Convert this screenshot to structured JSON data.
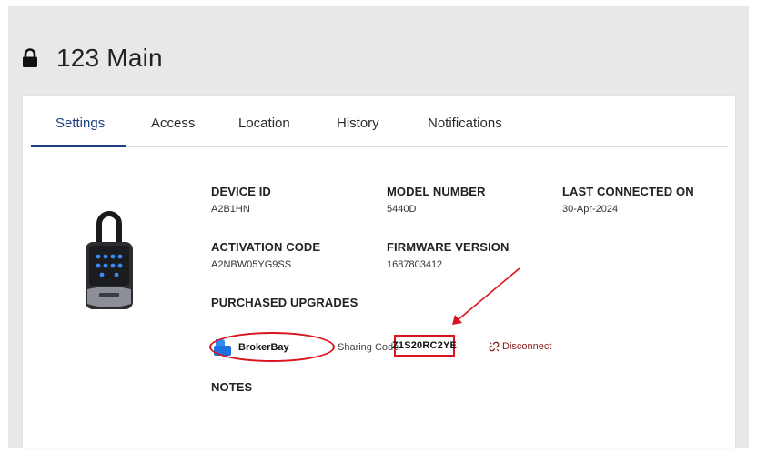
{
  "page": {
    "title": "123 Main"
  },
  "tabs": [
    {
      "label": "Settings",
      "active": true
    },
    {
      "label": "Access"
    },
    {
      "label": "Location"
    },
    {
      "label": "History"
    },
    {
      "label": "Notifications"
    }
  ],
  "details": {
    "device_id": {
      "label": "DEVICE ID",
      "value": "A2B1HN"
    },
    "model_number": {
      "label": "MODEL NUMBER",
      "value": "5440D"
    },
    "last_connected": {
      "label": "LAST CONNECTED ON",
      "value": "30-Apr-2024"
    },
    "activation_code": {
      "label": "ACTIVATION CODE",
      "value": "A2NBW05YG9SS"
    },
    "firmware_version": {
      "label": "FIRMWARE VERSION",
      "value": "1687803412"
    }
  },
  "upgrades": {
    "heading": "PURCHASED UPGRADES",
    "provider": "BrokerBay",
    "sharing_label": "Sharing Code",
    "sharing_code": "Z1S20RC2YE",
    "disconnect_label": "Disconnect"
  },
  "notes": {
    "heading": "NOTES"
  },
  "colors": {
    "accent": "#1d3f83",
    "annotation_red": "#d9141e",
    "disconnect_red": "#8b1a1a",
    "background_gray": "#e8e8ea"
  }
}
